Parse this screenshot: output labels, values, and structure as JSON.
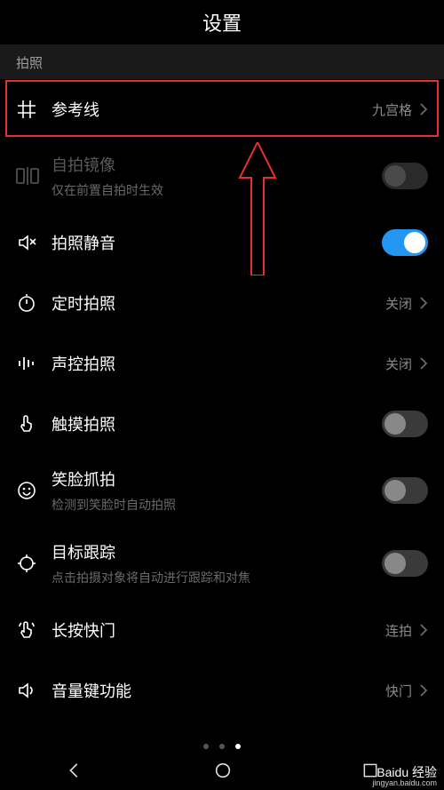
{
  "header": {
    "title": "设置"
  },
  "section": {
    "label": "拍照"
  },
  "rows": {
    "guideline": {
      "title": "参考线",
      "value": "九宫格"
    },
    "mirror": {
      "title": "自拍镜像",
      "sub": "仅在前置自拍时生效"
    },
    "mute": {
      "title": "拍照静音"
    },
    "timer": {
      "title": "定时拍照",
      "value": "关闭"
    },
    "voice": {
      "title": "声控拍照",
      "value": "关闭"
    },
    "touch": {
      "title": "触摸拍照"
    },
    "smile": {
      "title": "笑脸抓拍",
      "sub": "检测到笑脸时自动拍照"
    },
    "track": {
      "title": "目标跟踪",
      "sub": "点击拍摄对象将自动进行跟踪和对焦"
    },
    "longpress": {
      "title": "长按快门",
      "value": "连拍"
    },
    "volumekey": {
      "title": "音量键功能",
      "value": "快门"
    }
  },
  "watermark": {
    "brand": "Baidu 经验",
    "url": "jingyan.baidu.com"
  }
}
